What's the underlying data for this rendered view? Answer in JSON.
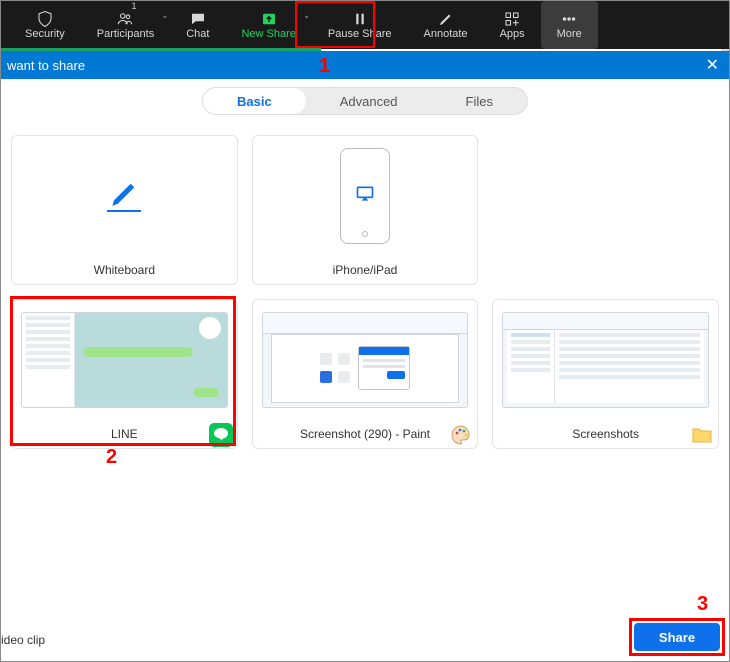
{
  "toolbar": {
    "items": [
      {
        "label": "Security",
        "icon": "shield"
      },
      {
        "label": "Participants",
        "icon": "people",
        "badge": "1",
        "caret": true
      },
      {
        "label": "Chat",
        "icon": "chat"
      },
      {
        "label": "New Share",
        "icon": "upload",
        "caret": true,
        "highlight": true
      },
      {
        "label": "Pause Share",
        "icon": "pause"
      },
      {
        "label": "Annotate",
        "icon": "pencil"
      },
      {
        "label": "Apps",
        "icon": "apps"
      },
      {
        "label": "More",
        "icon": "dots",
        "style": "more"
      }
    ]
  },
  "titlebar": {
    "text": "want to share",
    "close": "✕"
  },
  "tabs": {
    "items": [
      "Basic",
      "Advanced",
      "Files"
    ],
    "active": 0
  },
  "share_targets": [
    {
      "kind": "whiteboard",
      "label": "Whiteboard"
    },
    {
      "kind": "iphone",
      "label": "iPhone/iPad"
    },
    {
      "kind": "spacer"
    },
    {
      "kind": "line",
      "label": "LINE",
      "corner_icon": "line"
    },
    {
      "kind": "paint",
      "label": "Screenshot (290) - Paint",
      "corner_icon": "palette"
    },
    {
      "kind": "explorer",
      "label": "Screenshots",
      "corner_icon": "folder"
    }
  ],
  "bottom": {
    "left_text": "ideo clip",
    "share_label": "Share"
  },
  "annotations": {
    "step1": "1",
    "step2": "2",
    "step3": "3"
  },
  "colors": {
    "blue": "#0e71eb",
    "red": "#d80000",
    "green": "#23d160",
    "blue_bar": "#0078d4"
  }
}
